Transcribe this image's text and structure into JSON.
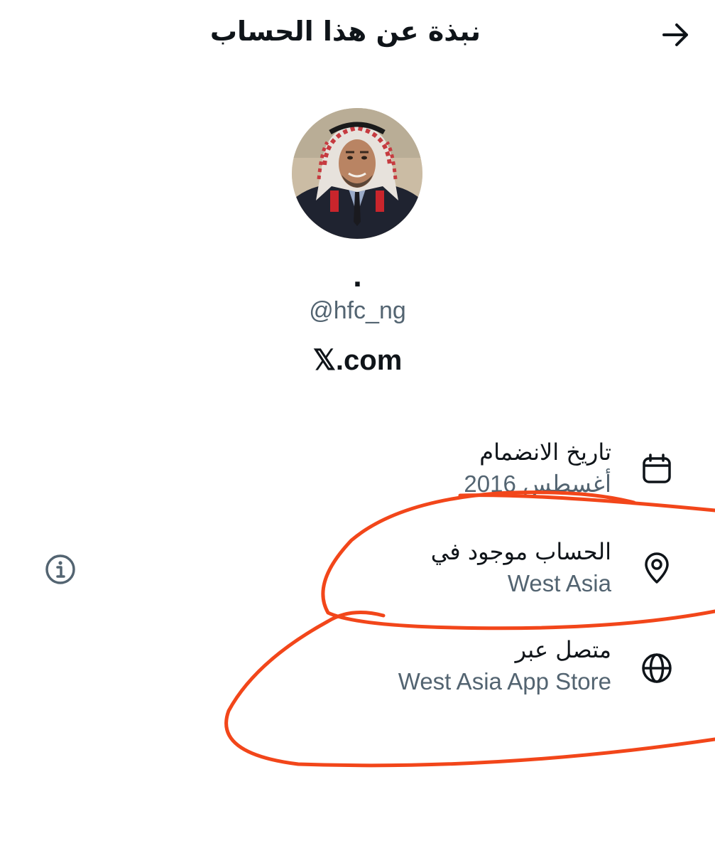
{
  "header": {
    "title": "نبذة عن هذا الحساب",
    "back_icon": "arrow-right-icon"
  },
  "profile": {
    "display_name": ".",
    "handle": "@hfc_ng",
    "site": "𝕏.com"
  },
  "details": [
    {
      "icon": "calendar-icon",
      "label": "تاريخ الانضمام",
      "value": "أغسطس 2016"
    },
    {
      "icon": "location-pin-icon",
      "label": "الحساب موجود في",
      "value": "West Asia"
    },
    {
      "icon": "globe-icon",
      "label": "متصل عبر",
      "value": "West Asia App Store"
    }
  ],
  "info_icon": "info-circle-icon",
  "colors": {
    "text_primary": "#0f1419",
    "text_secondary": "#536471",
    "annotation": "#f2461a"
  }
}
